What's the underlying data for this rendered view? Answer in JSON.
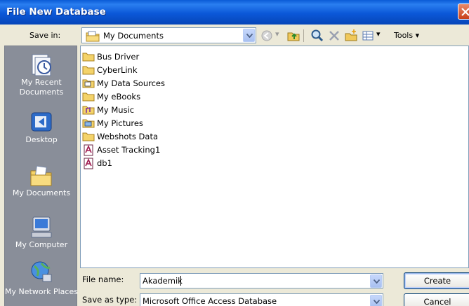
{
  "window": {
    "title": "File New Database"
  },
  "save_in": {
    "label": "Save in:",
    "value": "My Documents"
  },
  "toolbar": {
    "tools_label": "Tools",
    "icons": [
      "back-icon",
      "up-folder-icon",
      "search-web-icon",
      "delete-icon",
      "new-folder-icon",
      "views-icon"
    ]
  },
  "places": [
    {
      "label": "My Recent Documents",
      "icon": "recent-documents-icon"
    },
    {
      "label": "Desktop",
      "icon": "desktop-icon"
    },
    {
      "label": "My Documents",
      "icon": "my-documents-icon"
    },
    {
      "label": "My Computer",
      "icon": "my-computer-icon"
    },
    {
      "label": "My Network Places",
      "icon": "network-places-icon"
    }
  ],
  "files": [
    {
      "name": "Bus Driver",
      "type": "folder"
    },
    {
      "name": "CyberLink",
      "type": "folder"
    },
    {
      "name": "My Data Sources",
      "type": "data-sources-folder"
    },
    {
      "name": "My eBooks",
      "type": "folder"
    },
    {
      "name": "My Music",
      "type": "music-folder"
    },
    {
      "name": "My Pictures",
      "type": "pictures-folder"
    },
    {
      "name": "Webshots Data",
      "type": "folder"
    },
    {
      "name": "Asset Tracking1",
      "type": "access-db"
    },
    {
      "name": "db1",
      "type": "access-db"
    }
  ],
  "file_name": {
    "label": "File name:",
    "value": "Akademik"
  },
  "save_as_type": {
    "label": "Save as type:",
    "value": "Microsoft Office Access Database"
  },
  "buttons": {
    "create": "Create",
    "cancel": "Cancel"
  }
}
